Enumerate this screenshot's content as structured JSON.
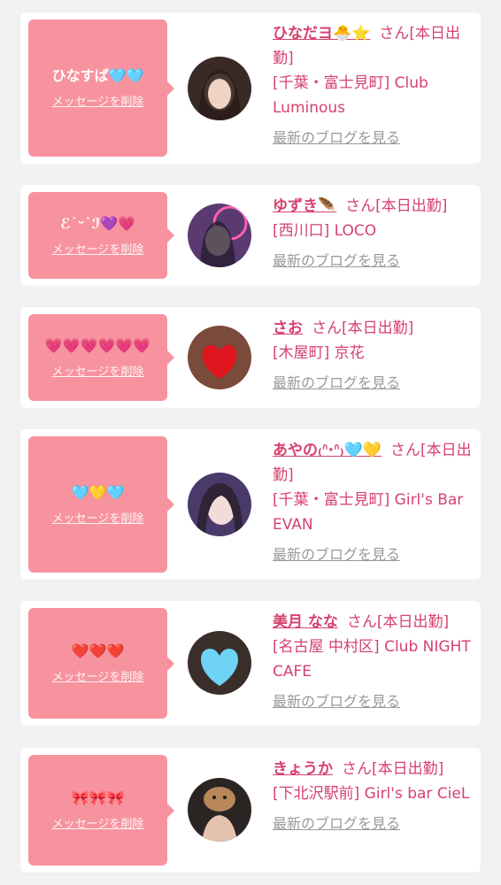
{
  "delete_label": "メッセージを削除",
  "blog_label": "最新のブログを見る",
  "cards": [
    {
      "message": "ひなすぱ🩵🩵",
      "name": "ひなだヨ🐣⭐",
      "san": "さん",
      "status": "[本日出勤]",
      "shop": "[千葉・富士見町] Club Luminous"
    },
    {
      "message": "ℰ˙ᵕ˙ℐ💜💗",
      "name": "ゆずき🪶",
      "san": "さん",
      "status": "[本日出勤]",
      "shop": "[西川口] LOCO"
    },
    {
      "message": "💗💗💗💗💗💗",
      "name": "さお",
      "san": "さん",
      "status": "[本日出勤]",
      "shop": "[木屋町] 京花"
    },
    {
      "message": "🩵💛🩵",
      "name": "あやの₍ᐢ·ᐢ₎🩵💛",
      "san": "さん",
      "status": "[本日出勤]",
      "shop": "[千葉・富士見町] Girl's Bar EVAN"
    },
    {
      "message": "❤️❤️❤️",
      "name": "美月 なな",
      "san": "さん",
      "status": "[本日出勤]",
      "shop": "[名古屋 中村区] Club NIGHT CAFE"
    },
    {
      "message": "🎀🎀🎀",
      "name": "きょうか",
      "san": "さん",
      "status": "[本日出勤]",
      "shop": "[下北沢駅前] Girl's bar CieL"
    }
  ]
}
